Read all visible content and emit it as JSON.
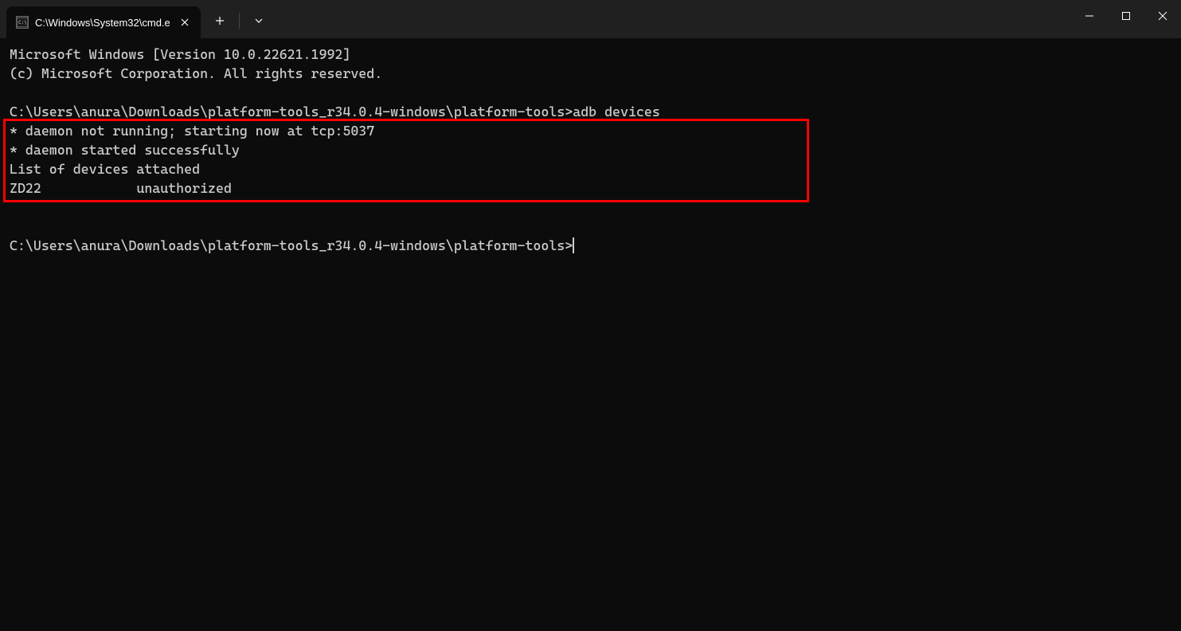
{
  "tab": {
    "title": "C:\\Windows\\System32\\cmd.e"
  },
  "terminal": {
    "line1": "Microsoft Windows [Version 10.0.22621.1992]",
    "line2": "(c) Microsoft Corporation. All rights reserved.",
    "blank1": "",
    "prompt1_path": "C:\\Users\\anura\\Downloads\\platform-tools_r34.0.4-windows\\platform-tools>",
    "prompt1_cmd": "adb devices",
    "output1": "* daemon not running; starting now at tcp:5037",
    "output2": "* daemon started successfully",
    "output3": "List of devices attached",
    "device_prefix": "ZD22",
    "device_status": "unauthorized",
    "blank2": "",
    "blank3": "",
    "prompt2_path": "C:\\Users\\anura\\Downloads\\platform-tools_r34.0.4-windows\\platform-tools>"
  }
}
